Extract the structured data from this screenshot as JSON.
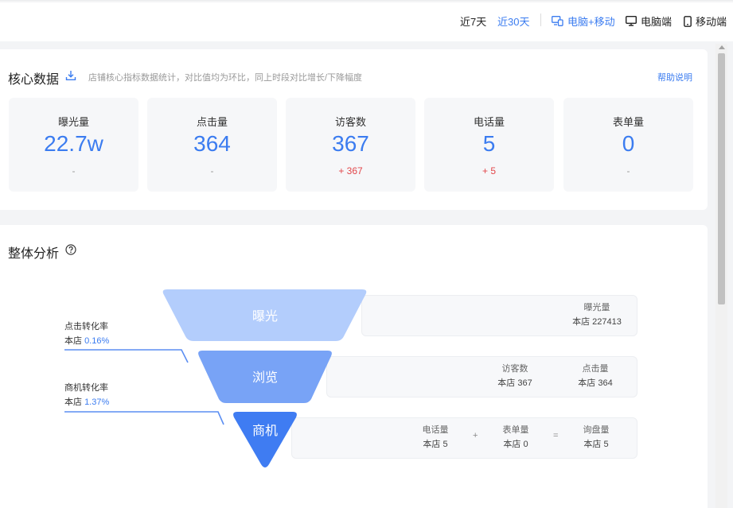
{
  "topbar": {
    "range_7": "近7天",
    "range_30": "近30天",
    "devices": [
      "电脑+移动",
      "电脑端",
      "移动端"
    ]
  },
  "core": {
    "title": "核心数据",
    "description": "店铺核心指标数据统计，对比值均为环比，同上时段对比增长/下降幅度",
    "help": "帮助说明",
    "metrics": [
      {
        "label": "曝光量",
        "value": "22.7w",
        "change": "-"
      },
      {
        "label": "点击量",
        "value": "364",
        "change": "-"
      },
      {
        "label": "访客数",
        "value": "367",
        "change": "+ 367"
      },
      {
        "label": "电话量",
        "value": "5",
        "change": "+ 5"
      },
      {
        "label": "表单量",
        "value": "0",
        "change": "-"
      }
    ]
  },
  "analysis": {
    "title": "整体分析",
    "funnel": [
      "曝光",
      "浏览",
      "商机"
    ],
    "rates": [
      {
        "name": "点击转化率",
        "prefix": "本店",
        "value": "0.16%"
      },
      {
        "name": "商机转化率",
        "prefix": "本店",
        "value": "1.37%"
      }
    ],
    "exposure": {
      "label": "曝光量",
      "value": "本店 227413"
    },
    "browse": [
      {
        "label": "访客数",
        "value": "本店 367"
      },
      {
        "label": "点击量",
        "value": "本店 364"
      }
    ],
    "leads": [
      {
        "label": "电话量",
        "value": "本店 5"
      },
      {
        "label": "表单量",
        "value": "本店 0"
      },
      {
        "label": "询盘量",
        "value": "本店 5"
      }
    ],
    "ops": [
      "+",
      "="
    ]
  },
  "colors": {
    "accent": "#3b7cf0",
    "up": "#e2474b",
    "funnel_top": "#b3cdfc",
    "funnel_mid": "#78a3f6",
    "funnel_bottom": "#3f7cf2"
  }
}
